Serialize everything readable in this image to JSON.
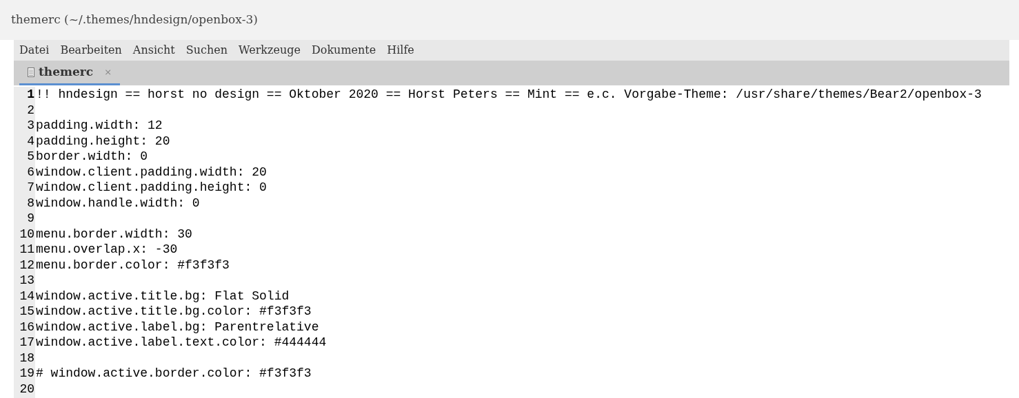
{
  "window": {
    "title": "themerc (~/.themes/hndesign/openbox-3)"
  },
  "menu": [
    "Datei",
    "Bearbeiten",
    "Ansicht",
    "Suchen",
    "Werkzeuge",
    "Dokumente",
    "Hilfe"
  ],
  "tabs": [
    {
      "label": "themerc",
      "close": "×",
      "selected": true
    }
  ],
  "editor": {
    "lines": [
      {
        "number": "1",
        "text": "!! hndesign == horst no design == Oktober 2020 == Horst Peters == Mint == e.c. Vorgabe-Theme: /usr/share/themes/Bear2/openbox-3",
        "current": true
      },
      {
        "number": "2",
        "current": false
      },
      {
        "number": "3",
        "text": "padding.width: 12",
        "current": false
      },
      {
        "number": "4",
        "text": "padding.height: 20",
        "current": false
      },
      {
        "number": "5",
        "text": "border.width: 0",
        "current": false
      },
      {
        "number": "6",
        "text": "window.client.padding.width: 20",
        "current": false
      },
      {
        "number": "7",
        "text": "window.client.padding.height: 0",
        "current": false
      },
      {
        "number": "8",
        "text": "window.handle.width: 0",
        "current": false
      },
      {
        "number": "9",
        "current": false
      },
      {
        "number": "10",
        "text": "menu.border.width: 30",
        "current": false
      },
      {
        "number": "11",
        "text": "menu.overlap.x: -30",
        "current": false
      },
      {
        "number": "12",
        "text": "menu.border.color: #f3f3f3",
        "current": false
      },
      {
        "number": "13",
        "current": false
      },
      {
        "number": "14",
        "text": "window.active.title.bg: Flat Solid",
        "current": false
      },
      {
        "number": "15",
        "text": "window.active.title.bg.color: #f3f3f3",
        "current": false
      },
      {
        "number": "16",
        "text": "window.active.label.bg: Parentrelative",
        "current": false
      },
      {
        "number": "17",
        "text": "window.active.label.text.color: #444444",
        "current": false
      },
      {
        "number": "18",
        "current": false
      },
      {
        "number": "19",
        "text": "# window.active.border.color: #f3f3f3",
        "current": false
      },
      {
        "number": "20",
        "current": false
      }
    ]
  }
}
